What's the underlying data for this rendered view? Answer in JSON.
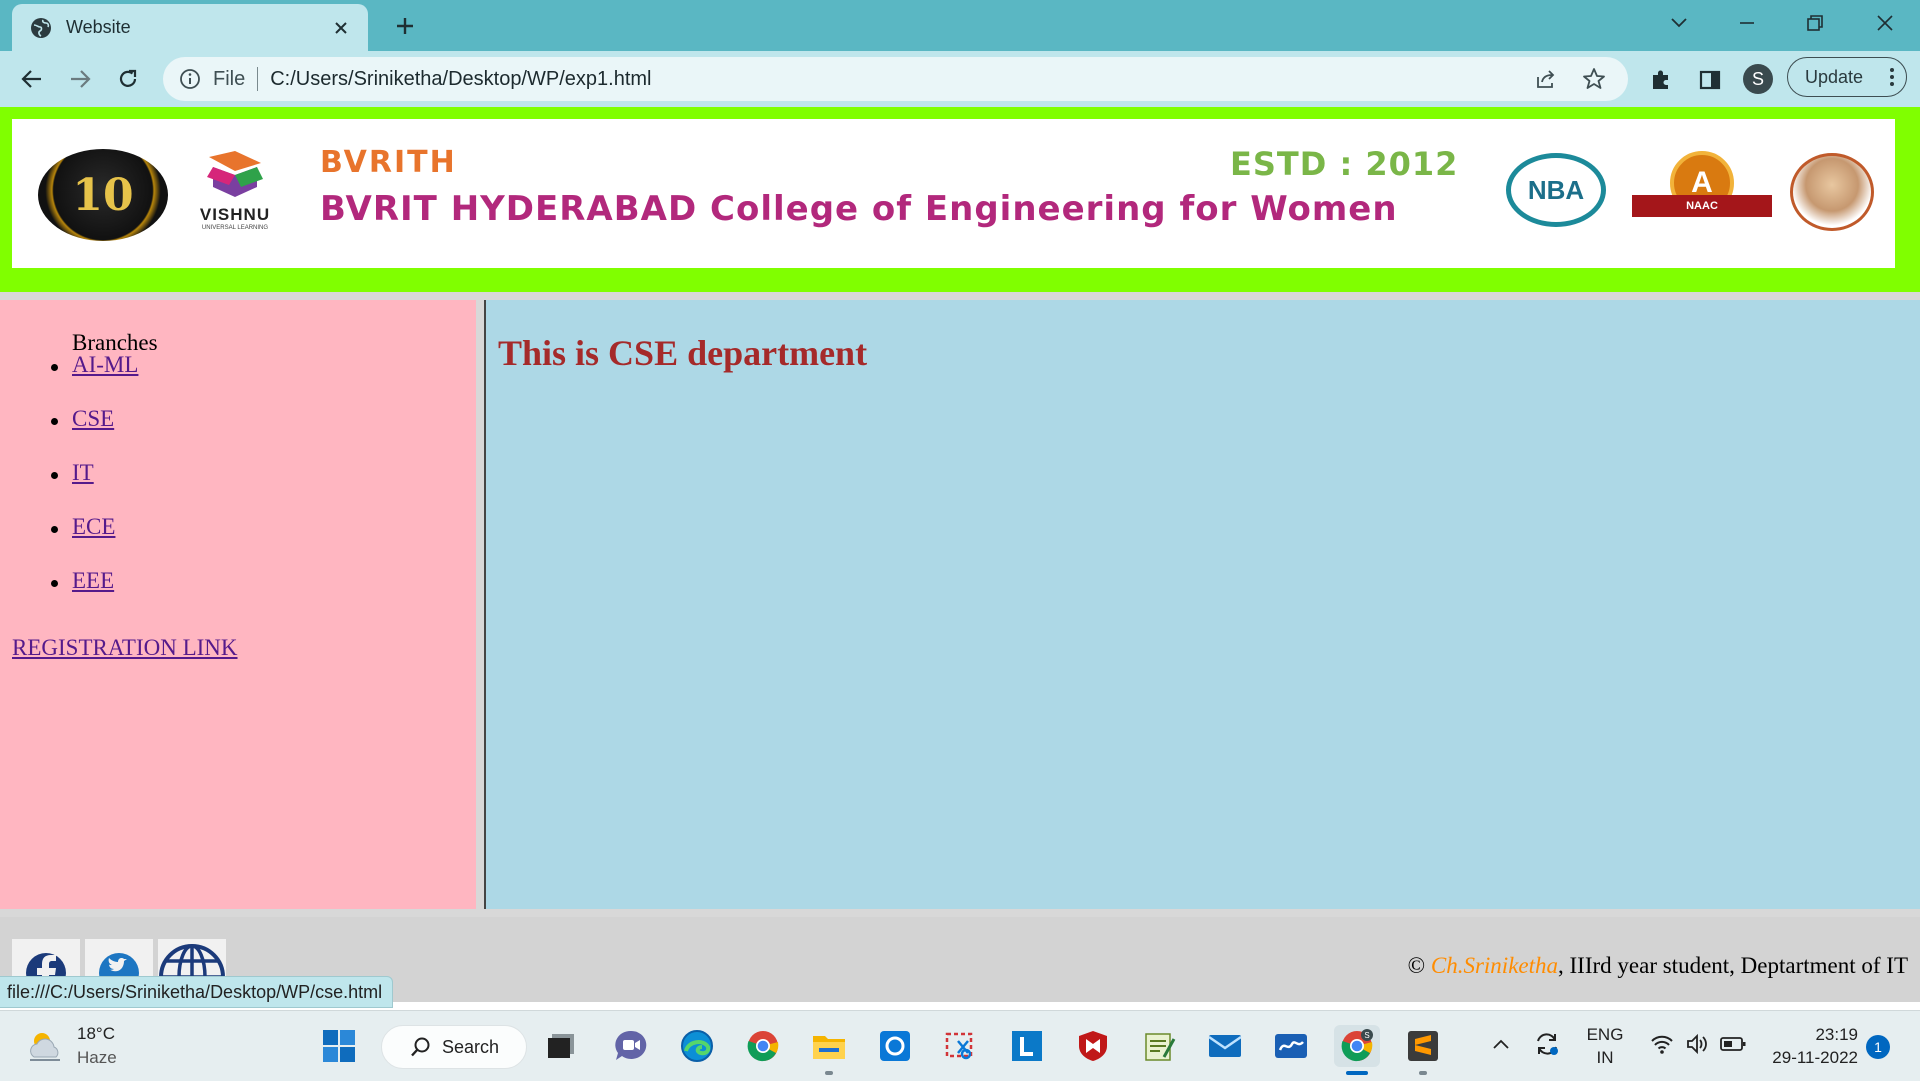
{
  "browser": {
    "tab_title": "Website",
    "omnibox_scheme": "File",
    "url": "C:/Users/Sriniketha/Desktop/WP/exp1.html",
    "update_label": "Update",
    "profile_initial": "S",
    "status_url": "file:///C:/Users/Sriniketha/Desktop/WP/cse.html"
  },
  "banner": {
    "college_short": "BVRITH",
    "estd": "ESTD : 2012",
    "college_full": "BVRIT HYDERABAD College of Engineering for Women",
    "ten_logo_text": "10",
    "vishnu_text": "VISHNU",
    "vishnu_sub": "UNIVERSAL LEARNING",
    "nba_text": "NBA",
    "naac_grade": "A",
    "naac_text": "NAAC"
  },
  "sidebar": {
    "heading": "Branches",
    "branches": [
      "AI-ML",
      "CSE",
      "IT",
      "ECE",
      "EEE"
    ],
    "registration_link": "REGISTRATION LINK"
  },
  "content": {
    "title": "This is CSE department"
  },
  "footer": {
    "copyright_symbol": "©",
    "author": "Ch.Sriniketha",
    "rest": ", IIIrd year student, Deptartment of IT"
  },
  "taskbar": {
    "temperature": "18°C",
    "weather": "Haze",
    "search_label": "Search",
    "lang_line1": "ENG",
    "lang_line2": "IN",
    "time": "23:19",
    "date": "29-11-2022",
    "notification_count": "1",
    "chrome_badge": "S"
  },
  "colors": {
    "tab_strip": "#5ab7c3",
    "toolbar": "#bfe6ec",
    "header_frame": "#80ff00",
    "sidebar": "#ffb6c1",
    "content": "#add8e6",
    "title_text": "#a52a2a",
    "link": "#551a8b",
    "author": "#ff8c00"
  }
}
